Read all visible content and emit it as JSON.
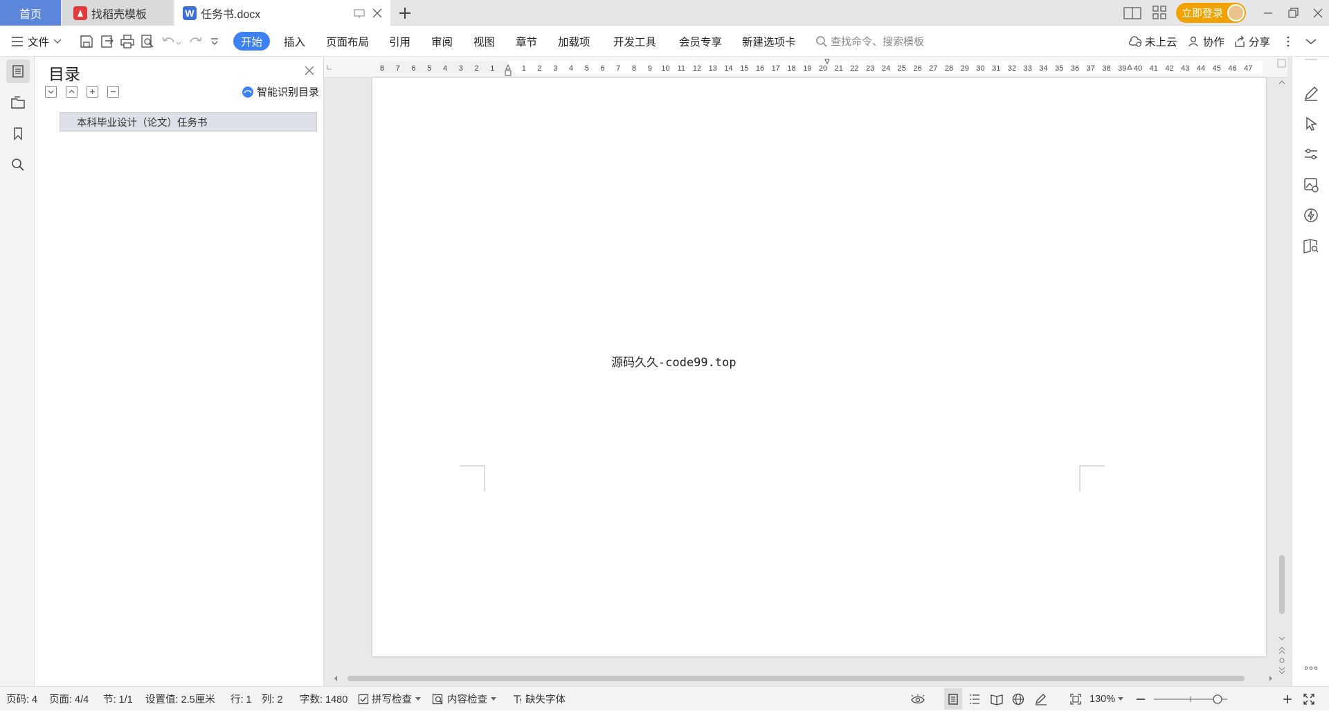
{
  "tabs": {
    "home": "首页",
    "docer": "找稻壳模板",
    "document": "任务书.docx"
  },
  "window": {
    "login_label": "立即登录"
  },
  "ribbon": {
    "file_label": "文件",
    "menus": [
      "开始",
      "插入",
      "页面布局",
      "引用",
      "审阅",
      "视图",
      "章节",
      "加载项",
      "开发工具",
      "会员专享",
      "新建选项卡"
    ],
    "active_menu": "开始",
    "search_placeholder": "查找命令、搜索模板",
    "cloud_label": "未上云",
    "collab_label": "协作",
    "share_label": "分享",
    "accent_color": "#3c82f5"
  },
  "toc": {
    "title": "目录",
    "smart_label": "智能识别目录",
    "items": [
      "本科毕业设计（论文）任务书"
    ]
  },
  "ruler": {
    "left_ticks": [
      "8",
      "7",
      "6",
      "5",
      "4",
      "3",
      "2",
      "1"
    ],
    "right_ticks": [
      "1",
      "2",
      "3",
      "4",
      "5",
      "6",
      "7",
      "8",
      "9",
      "10",
      "11",
      "12",
      "13",
      "14",
      "15",
      "16",
      "17",
      "18",
      "19",
      "20",
      "21",
      "22",
      "23",
      "24",
      "25",
      "26",
      "27",
      "28",
      "29",
      "30",
      "31",
      "32",
      "33",
      "34",
      "35",
      "36",
      "37",
      "38",
      "39",
      "40",
      "41",
      "42",
      "43",
      "44",
      "45",
      "46",
      "47"
    ]
  },
  "document": {
    "body_text": "源码久久-code99.top"
  },
  "status": {
    "page_code": "页码: 4",
    "pages": "页面: 4/4",
    "section": "节: 1/1",
    "setting": "设置值: 2.5厘米",
    "line": "行: 1",
    "column": "列: 2",
    "word_count": "字数: 1480",
    "spell_check": "拼写检查",
    "content_check": "内容检查",
    "missing_font": "缺失字体",
    "zoom": "130%"
  }
}
